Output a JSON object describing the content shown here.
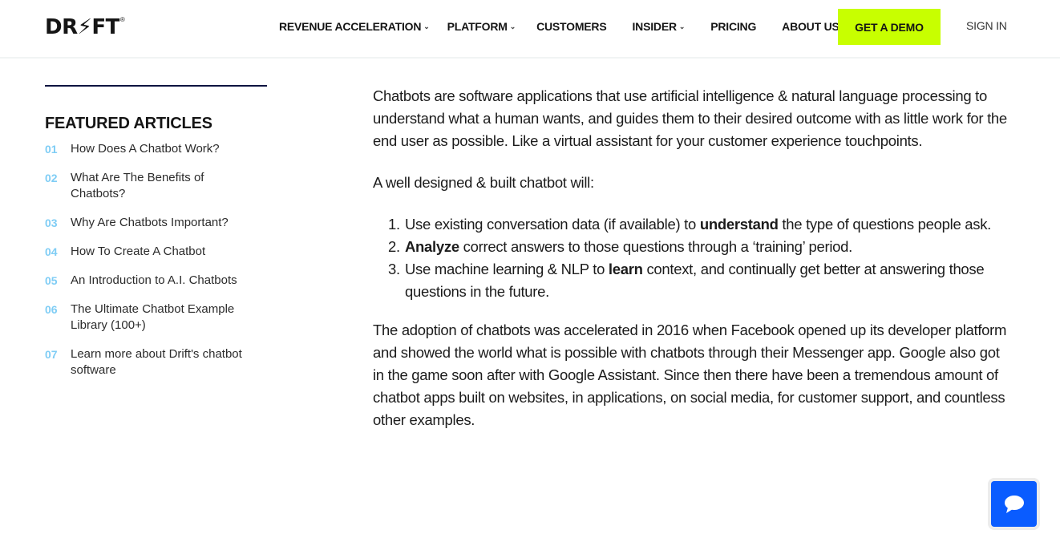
{
  "brand": {
    "logo_text": "DR⚡FT",
    "logo_mark": "®"
  },
  "nav": {
    "items": [
      {
        "label": "REVENUE ACCELERATION",
        "has_dropdown": true
      },
      {
        "label": "PLATFORM",
        "has_dropdown": true
      },
      {
        "label": "CUSTOMERS",
        "has_dropdown": false
      },
      {
        "label": "INSIDER",
        "has_dropdown": true
      },
      {
        "label": "PRICING",
        "has_dropdown": false
      },
      {
        "label": "ABOUT US",
        "has_dropdown": true
      }
    ],
    "chevron": "⌄",
    "demo_label": "GET A DEMO",
    "signin_label": "SIGN IN"
  },
  "colors": {
    "accent": "#c8ff00",
    "number": "#7fcdf5",
    "chat": "#0a5cff",
    "rule": "#0e1340"
  },
  "sidebar": {
    "title": "FEATURED ARTICLES",
    "articles": [
      {
        "num": "01",
        "label": "How Does A Chatbot Work?"
      },
      {
        "num": "02",
        "label": "What Are The Benefits of Chatbots?"
      },
      {
        "num": "03",
        "label": "Why Are Chatbots Important?"
      },
      {
        "num": "04",
        "label": "How To Create A Chatbot"
      },
      {
        "num": "05",
        "label": "An Introduction to A.I. Chatbots"
      },
      {
        "num": "06",
        "label": "The Ultimate Chatbot Example Library (100+)"
      },
      {
        "num": "07",
        "label": "Learn more about Drift's chatbot software"
      }
    ]
  },
  "article": {
    "intro": "Chatbots are software applications that use artificial intelligence & natural language processing to understand what a human wants, and guides them to their desired outcome with as little work for the end user as possible. Like a virtual assistant for your customer experience touchpoints.",
    "lead": "A well designed & built chatbot will:",
    "list": [
      {
        "num": "1.",
        "before": "Use existing conversation data (if available) to ",
        "bold": "understand",
        "after": " the type of questions people ask."
      },
      {
        "num": "2.",
        "before": "",
        "bold": "Analyze",
        "after": " correct answers to those questions through a ‘training’ period."
      },
      {
        "num": "3.",
        "before": "Use machine learning & NLP to ",
        "bold": "learn",
        "after": " context, and continually get better at answering those questions in the future."
      }
    ],
    "closing": "The adoption of chatbots was accelerated in 2016 when Facebook opened up its developer platform and showed the world what is possible with chatbots through their Messenger app. Google also got in the game soon after with Google Assistant. Since then there have been a tremendous amount of chatbot apps built on websites, in applications, on social media, for customer support, and countless other examples."
  },
  "chat_widget": {
    "icon": "chat-bubble-icon"
  }
}
